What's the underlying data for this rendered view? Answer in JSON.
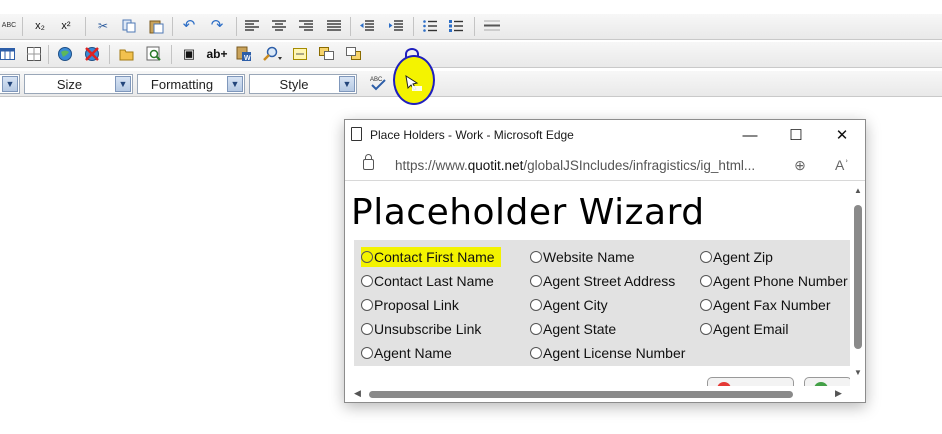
{
  "toolbar": {
    "size_label": "Size",
    "formatting_label": "Formatting",
    "style_label": "Style",
    "spellcheck_text": "ABC",
    "subscript_text": "x₂",
    "superscript_text": "x²",
    "insert_word_text": "ab+"
  },
  "popup": {
    "window_title": "Place Holders - Work - Microsoft Edge",
    "minimize": "—",
    "maximize": "☐",
    "close": "✕",
    "url_prefix": "https://www.",
    "url_domain": "quotit.net",
    "url_path": "/globalJSIncludes/infragistics/ig_html...",
    "heading": "Placeholder Wizard",
    "options": [
      {
        "label": "Contact First Name",
        "highlighted": true
      },
      {
        "label": "Website Name"
      },
      {
        "label": "Agent Zip"
      },
      {
        "label": "Contact Last Name"
      },
      {
        "label": "Agent Street Address"
      },
      {
        "label": "Agent Phone Number"
      },
      {
        "label": "Proposal Link"
      },
      {
        "label": "Agent City"
      },
      {
        "label": "Agent Fax Number"
      },
      {
        "label": "Unsubscribe Link"
      },
      {
        "label": "Agent State"
      },
      {
        "label": "Agent Email"
      },
      {
        "label": "Agent Name"
      },
      {
        "label": "Agent License Number"
      }
    ]
  },
  "colors": {
    "highlight": "#f3f300",
    "annotation_ink": "#1f1fbd"
  }
}
